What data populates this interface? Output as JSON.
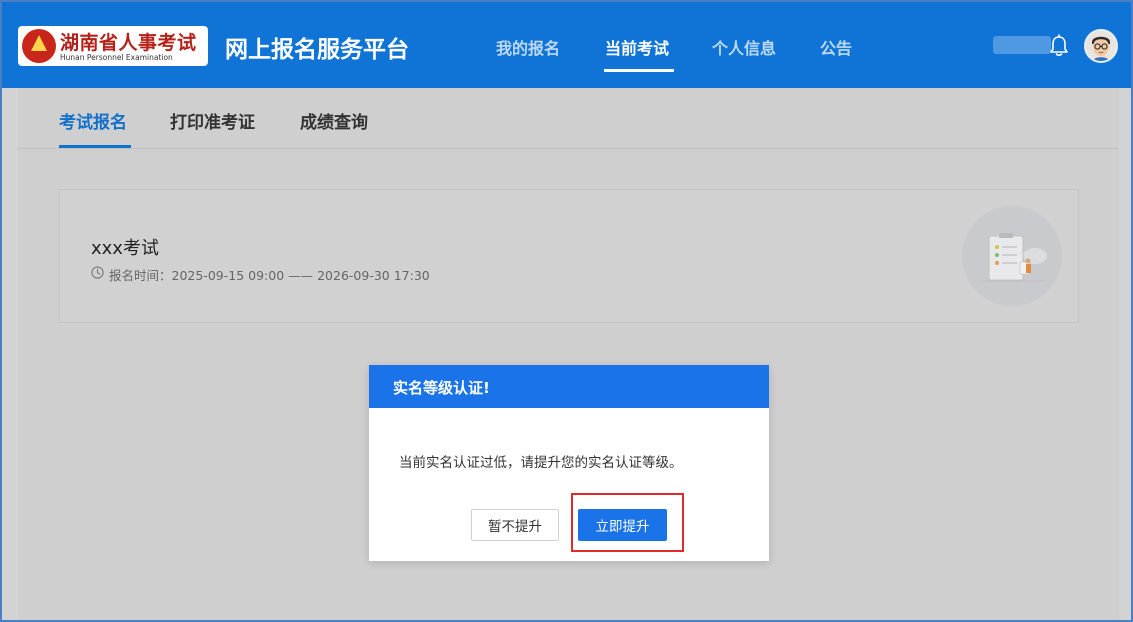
{
  "header": {
    "logo_cn": "湖南省人事考试",
    "logo_en": "Hunan Personnel Examination",
    "platform_title": "网上报名服务平台",
    "nav": [
      {
        "label": "我的报名",
        "active": false
      },
      {
        "label": "当前考试",
        "active": true
      },
      {
        "label": "个人信息",
        "active": false
      },
      {
        "label": "公告",
        "active": false
      }
    ],
    "bell_icon": "bell-icon",
    "avatar_icon": "user-avatar"
  },
  "subtabs": [
    {
      "label": "考试报名",
      "active": true
    },
    {
      "label": "打印准考证",
      "active": false
    },
    {
      "label": "成绩查询",
      "active": false
    }
  ],
  "exam": {
    "name": "xxx考试",
    "time_label": "报名时间：2025-09-15 09:00 —— 2026-09-30 17:30",
    "clock_icon": "clock-icon",
    "illustration_icon": "clipboard-illustration"
  },
  "modal": {
    "title": "实名等级认证!",
    "message": "当前实名认证过低，请提升您的实名认证等级。",
    "cancel_label": "暂不提升",
    "confirm_label": "立即提升"
  },
  "colors": {
    "header_bg": "#0f74d6",
    "primary": "#1a73e8",
    "tab_active": "#1171cc",
    "highlight": "#e02b2b",
    "logo_red": "#b5221a"
  }
}
